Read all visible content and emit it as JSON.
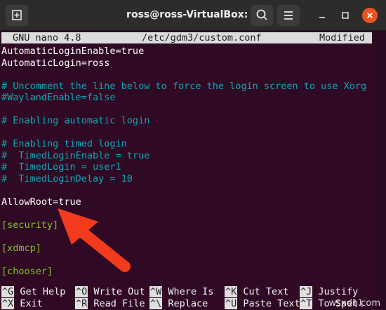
{
  "window": {
    "title": "ross@ross-VirtualBox: ~"
  },
  "nano": {
    "header": {
      "app": "GNU nano 4.8",
      "file": "/etc/gdm3/custom.conf",
      "status": "Modified"
    },
    "lines": [
      {
        "text": "AutomaticLoginEnable=true",
        "kind": "white"
      },
      {
        "text": "AutomaticLogin=ross",
        "kind": "white"
      },
      {
        "text": "",
        "kind": "white"
      },
      {
        "text": "# Uncomment the line below to force the login screen to use Xorg",
        "kind": "comment"
      },
      {
        "text": "#WaylandEnable=false",
        "kind": "comment"
      },
      {
        "text": "",
        "kind": "white"
      },
      {
        "text": "# Enabling automatic login",
        "kind": "comment"
      },
      {
        "text": "",
        "kind": "white"
      },
      {
        "text": "# Enabling timed login",
        "kind": "comment"
      },
      {
        "text": "#  TimedLoginEnable = true",
        "kind": "comment"
      },
      {
        "text": "#  TimedLogin = user1",
        "kind": "comment"
      },
      {
        "text": "#  TimedLoginDelay = 10",
        "kind": "comment"
      },
      {
        "text": "",
        "kind": "white"
      },
      {
        "text": "AllowRoot=true",
        "kind": "white"
      },
      {
        "text": "",
        "kind": "white"
      },
      {
        "text": "[security]",
        "kind": "section"
      },
      {
        "text": "",
        "kind": "white"
      },
      {
        "text": "[xdmcp]",
        "kind": "section"
      },
      {
        "text": "",
        "kind": "white"
      },
      {
        "text": "[chooser]",
        "kind": "section"
      }
    ],
    "shortcuts_row1": [
      {
        "key": "^G",
        "label": "Get Help"
      },
      {
        "key": "^O",
        "label": "Write Out"
      },
      {
        "key": "^W",
        "label": "Where Is"
      },
      {
        "key": "^K",
        "label": "Cut Text"
      },
      {
        "key": "^J",
        "label": "Justify"
      }
    ],
    "shortcuts_row2": [
      {
        "key": "^X",
        "label": "Exit"
      },
      {
        "key": "^R",
        "label": "Read File"
      },
      {
        "key": "^\\",
        "label": "Replace"
      },
      {
        "key": "^U",
        "label": "Paste Text"
      },
      {
        "key": "^T",
        "label": "To Spell"
      }
    ]
  },
  "watermark": "wsxdn.com",
  "colors": {
    "terminal_bg": "#300a24",
    "comment": "#0ea6b6",
    "section": "#7ec71d",
    "arrow": "#f23a1c",
    "close_button": "#e95420"
  },
  "icons": [
    "new-tab-icon",
    "search-icon",
    "menu-icon",
    "minimize-icon",
    "maximize-icon",
    "close-icon"
  ]
}
